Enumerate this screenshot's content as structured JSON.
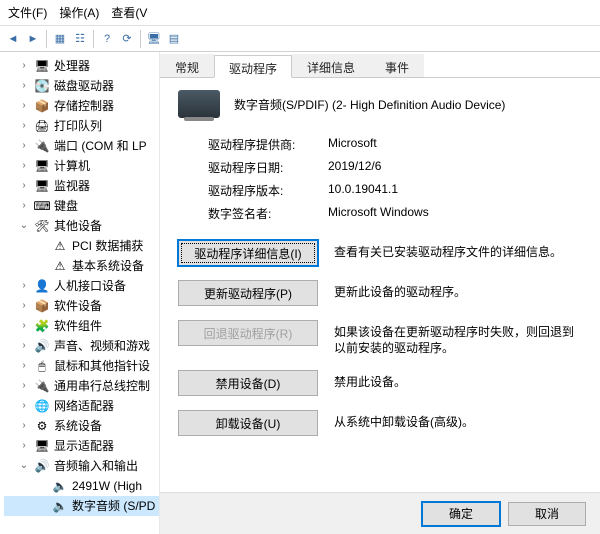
{
  "menubar": {
    "file": "文件(F)",
    "action": "操作(A)",
    "view": "查看(V"
  },
  "tree": [
    {
      "lvl": 1,
      "tw": ">",
      "icon": "🖥",
      "label": "处理器"
    },
    {
      "lvl": 1,
      "tw": ">",
      "icon": "💽",
      "label": "磁盘驱动器"
    },
    {
      "lvl": 1,
      "tw": ">",
      "icon": "📦",
      "label": "存储控制器"
    },
    {
      "lvl": 1,
      "tw": ">",
      "icon": "🖨",
      "label": "打印队列"
    },
    {
      "lvl": 1,
      "tw": ">",
      "icon": "🔌",
      "label": "端口 (COM 和 LP"
    },
    {
      "lvl": 1,
      "tw": ">",
      "icon": "🖥",
      "label": "计算机"
    },
    {
      "lvl": 1,
      "tw": ">",
      "icon": "🖥",
      "label": "监视器"
    },
    {
      "lvl": 1,
      "tw": ">",
      "icon": "⌨",
      "label": "键盘"
    },
    {
      "lvl": 1,
      "tw": "v",
      "icon": "🛠",
      "label": "其他设备"
    },
    {
      "lvl": 2,
      "tw": "",
      "icon": "⚠",
      "label": "PCI 数据捕获"
    },
    {
      "lvl": 2,
      "tw": "",
      "icon": "⚠",
      "label": "基本系统设备"
    },
    {
      "lvl": 1,
      "tw": ">",
      "icon": "👤",
      "label": "人机接口设备"
    },
    {
      "lvl": 1,
      "tw": ">",
      "icon": "📦",
      "label": "软件设备"
    },
    {
      "lvl": 1,
      "tw": ">",
      "icon": "🧩",
      "label": "软件组件"
    },
    {
      "lvl": 1,
      "tw": ">",
      "icon": "🔊",
      "label": "声音、视频和游戏"
    },
    {
      "lvl": 1,
      "tw": ">",
      "icon": "🖱",
      "label": "鼠标和其他指针设"
    },
    {
      "lvl": 1,
      "tw": ">",
      "icon": "🔌",
      "label": "通用串行总线控制"
    },
    {
      "lvl": 1,
      "tw": ">",
      "icon": "🌐",
      "label": "网络适配器"
    },
    {
      "lvl": 1,
      "tw": ">",
      "icon": "⚙",
      "label": "系统设备"
    },
    {
      "lvl": 1,
      "tw": ">",
      "icon": "🖥",
      "label": "显示适配器"
    },
    {
      "lvl": 1,
      "tw": "v",
      "icon": "🔊",
      "label": "音频输入和输出"
    },
    {
      "lvl": 2,
      "tw": "",
      "icon": "🔈",
      "label": "2491W (High"
    },
    {
      "lvl": 2,
      "tw": "",
      "icon": "🔈",
      "label": "数字音频 (S/PD",
      "selected": true
    }
  ],
  "tabs": {
    "general": "常规",
    "driver": "驱动程序",
    "details": "详细信息",
    "events": "事件"
  },
  "device": {
    "title": "数字音频(S/PDIF) (2- High Definition Audio Device)"
  },
  "fields": {
    "provider_k": "驱动程序提供商:",
    "provider_v": "Microsoft",
    "date_k": "驱动程序日期:",
    "date_v": "2019/12/6",
    "version_k": "驱动程序版本:",
    "version_v": "10.0.19041.1",
    "signer_k": "数字签名者:",
    "signer_v": "Microsoft Windows"
  },
  "actions": {
    "details_btn": "驱动程序详细信息(I)",
    "details_desc": "查看有关已安装驱动程序文件的详细信息。",
    "update_btn": "更新驱动程序(P)",
    "update_desc": "更新此设备的驱动程序。",
    "rollback_btn": "回退驱动程序(R)",
    "rollback_desc": "如果该设备在更新驱动程序时失败，则回退到以前安装的驱动程序。",
    "disable_btn": "禁用设备(D)",
    "disable_desc": "禁用此设备。",
    "uninstall_btn": "卸载设备(U)",
    "uninstall_desc": "从系统中卸载设备(高级)。"
  },
  "dialog": {
    "ok": "确定",
    "cancel": "取消"
  }
}
